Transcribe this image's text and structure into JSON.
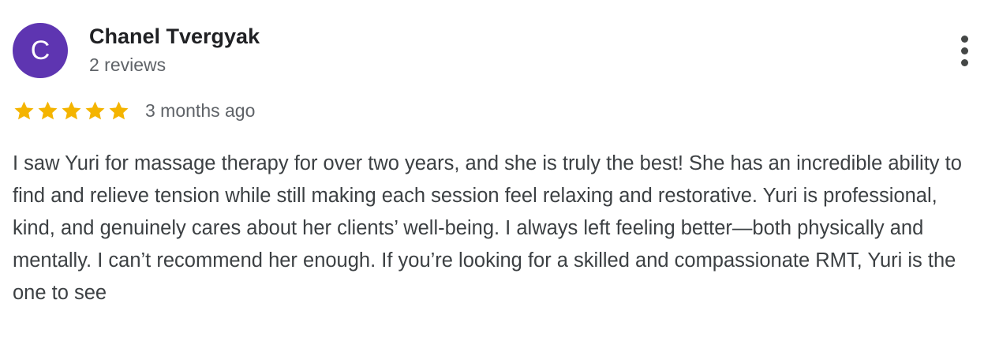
{
  "reviewer": {
    "avatar_initial": "C",
    "avatar_color": "#5e35b1",
    "name": "Chanel Tvergyak",
    "review_count": "2 reviews"
  },
  "rating": {
    "stars": 5,
    "max_stars": 5,
    "star_color": "#f4b400",
    "date": "3 months ago"
  },
  "review": {
    "text": "I saw Yuri for massage therapy for over two years, and she is truly the best! She has an incredible ability to find and relieve tension while still making each session feel relaxing and restorative. Yuri is professional, kind, and genuinely cares about her clients’ well-being. I always left feeling better—both physically and mentally. I can’t recommend her enough. If you’re looking for a skilled and compassionate RMT, Yuri is the one to see"
  },
  "menu": {
    "icon": "more-vert-icon"
  }
}
